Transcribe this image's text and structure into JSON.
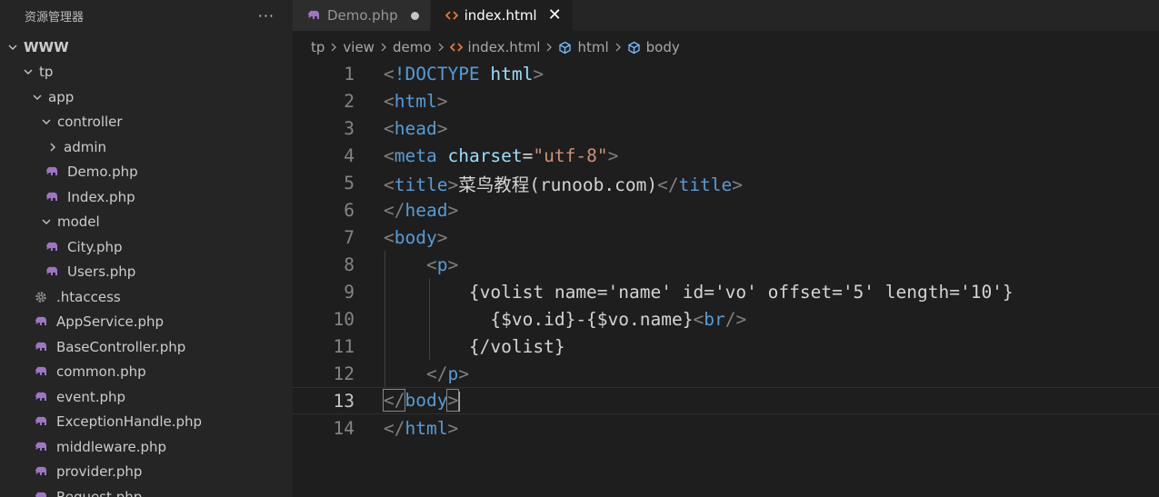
{
  "sidebar": {
    "title": "资源管理器",
    "more": "···",
    "tree": [
      {
        "label": "WWW",
        "chevron": "down",
        "icon": "",
        "level": 0,
        "bold": true
      },
      {
        "label": "tp",
        "chevron": "down",
        "icon": "",
        "level": 1
      },
      {
        "label": "app",
        "chevron": "down",
        "icon": "",
        "level": 2
      },
      {
        "label": "controller",
        "chevron": "down",
        "icon": "",
        "level": 3
      },
      {
        "label": "admin",
        "chevron": "right",
        "icon": "",
        "level": 4
      },
      {
        "label": "Demo.php",
        "chevron": "",
        "icon": "php-elephant-icon",
        "level": 4
      },
      {
        "label": "Index.php",
        "chevron": "",
        "icon": "php-elephant-icon",
        "level": 4
      },
      {
        "label": "model",
        "chevron": "down",
        "icon": "",
        "level": 3
      },
      {
        "label": "City.php",
        "chevron": "",
        "icon": "php-elephant-icon",
        "level": 4
      },
      {
        "label": "Users.php",
        "chevron": "",
        "icon": "php-elephant-icon",
        "level": 4
      },
      {
        "label": ".htaccess",
        "chevron": "",
        "icon": "gear-icon",
        "level": 3
      },
      {
        "label": "AppService.php",
        "chevron": "",
        "icon": "php-elephant-icon",
        "level": 3
      },
      {
        "label": "BaseController.php",
        "chevron": "",
        "icon": "php-elephant-icon",
        "level": 3
      },
      {
        "label": "common.php",
        "chevron": "",
        "icon": "php-elephant-icon",
        "level": 3
      },
      {
        "label": "event.php",
        "chevron": "",
        "icon": "php-elephant-icon",
        "level": 3
      },
      {
        "label": "ExceptionHandle.php",
        "chevron": "",
        "icon": "php-elephant-icon",
        "level": 3
      },
      {
        "label": "middleware.php",
        "chevron": "",
        "icon": "php-elephant-icon",
        "level": 3
      },
      {
        "label": "provider.php",
        "chevron": "",
        "icon": "php-elephant-icon",
        "level": 3
      },
      {
        "label": "Request.php",
        "chevron": "",
        "icon": "php-elephant-icon",
        "level": 3
      }
    ]
  },
  "tabs": [
    {
      "label": "Demo.php",
      "icon": "php-elephant-icon",
      "active": false,
      "modified": true
    },
    {
      "label": "index.html",
      "icon": "html-code-icon",
      "active": true,
      "modified": false,
      "close": "✕"
    }
  ],
  "breadcrumb": [
    {
      "label": "tp",
      "icon": ""
    },
    {
      "label": "view",
      "icon": ""
    },
    {
      "label": "demo",
      "icon": ""
    },
    {
      "label": "index.html",
      "icon": "html-code-icon"
    },
    {
      "label": "html",
      "icon": "cube-symbol-icon"
    },
    {
      "label": "body",
      "icon": "cube-symbol-icon"
    }
  ],
  "code": {
    "current_line": 13,
    "lines": [
      {
        "n": "1",
        "indent": 0,
        "tokens": [
          [
            "ang",
            "<"
          ],
          [
            "tag",
            "!DOCTYPE"
          ],
          [
            "plain",
            " "
          ],
          [
            "attr",
            "html"
          ],
          [
            "ang",
            ">"
          ]
        ]
      },
      {
        "n": "2",
        "indent": 0,
        "tokens": [
          [
            "ang",
            "<"
          ],
          [
            "tag",
            "html"
          ],
          [
            "ang",
            ">"
          ]
        ]
      },
      {
        "n": "3",
        "indent": 0,
        "tokens": [
          [
            "ang",
            "<"
          ],
          [
            "tag",
            "head"
          ],
          [
            "ang",
            ">"
          ]
        ]
      },
      {
        "n": "4",
        "indent": 0,
        "tokens": [
          [
            "ang",
            "<"
          ],
          [
            "tag",
            "meta"
          ],
          [
            "plain",
            " "
          ],
          [
            "attr",
            "charset"
          ],
          [
            "plain",
            "="
          ],
          [
            "str",
            "\"utf-8\""
          ],
          [
            "ang",
            ">"
          ]
        ]
      },
      {
        "n": "5",
        "indent": 0,
        "tokens": [
          [
            "ang",
            "<"
          ],
          [
            "tag",
            "title"
          ],
          [
            "ang",
            ">"
          ],
          [
            "plain",
            "菜鸟教程(runoob.com)"
          ],
          [
            "ang",
            "</"
          ],
          [
            "tag",
            "title"
          ],
          [
            "ang",
            ">"
          ]
        ]
      },
      {
        "n": "6",
        "indent": 0,
        "tokens": [
          [
            "ang",
            "</"
          ],
          [
            "tag",
            "head"
          ],
          [
            "ang",
            ">"
          ]
        ]
      },
      {
        "n": "7",
        "indent": 0,
        "tokens": [
          [
            "ang",
            "<"
          ],
          [
            "tag",
            "body"
          ],
          [
            "ang",
            ">"
          ]
        ]
      },
      {
        "n": "8",
        "indent": 1,
        "tokens": [
          [
            "plain",
            "    "
          ],
          [
            "ang",
            "<"
          ],
          [
            "tag",
            "p"
          ],
          [
            "ang",
            ">"
          ]
        ]
      },
      {
        "n": "9",
        "indent": 2,
        "tokens": [
          [
            "plain",
            "        {volist name='name' id='vo' offset='5' length='10'}"
          ]
        ]
      },
      {
        "n": "10",
        "indent": 2,
        "tokens": [
          [
            "plain",
            "          {$vo.id}-{$vo.name}"
          ],
          [
            "ang",
            "<"
          ],
          [
            "tag",
            "br"
          ],
          [
            "ang",
            "/>"
          ]
        ]
      },
      {
        "n": "11",
        "indent": 2,
        "tokens": [
          [
            "plain",
            "        {/volist}"
          ]
        ]
      },
      {
        "n": "12",
        "indent": 1,
        "tokens": [
          [
            "plain",
            "    "
          ],
          [
            "ang",
            "</"
          ],
          [
            "tag",
            "p"
          ],
          [
            "ang",
            ">"
          ]
        ]
      },
      {
        "n": "13",
        "indent": 0,
        "tokens": [
          [
            "ang",
            "</"
          ],
          [
            "tag",
            "body"
          ],
          [
            "ang",
            ">"
          ]
        ]
      },
      {
        "n": "14",
        "indent": 0,
        "tokens": [
          [
            "ang",
            "</"
          ],
          [
            "tag",
            "html"
          ],
          [
            "ang",
            ">"
          ]
        ]
      }
    ]
  },
  "colors": {
    "php_icon": "#a074c4",
    "html_icon": "#e37933",
    "symbol_icon": "#75beff",
    "gear_icon": "#8c8c8c"
  }
}
